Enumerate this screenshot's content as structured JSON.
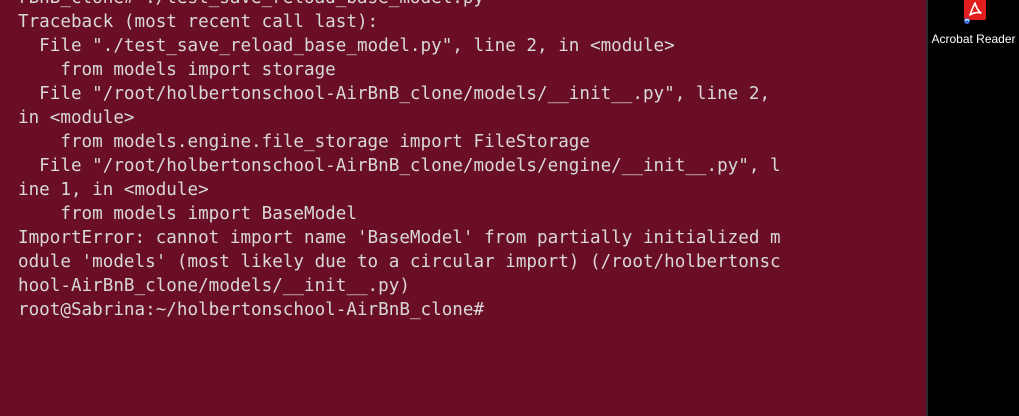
{
  "terminal": {
    "lines": [
      "rBnB_clone# ./test_save_reload_base_model.py",
      "Traceback (most recent call last):",
      "  File \"./test_save_reload_base_model.py\", line 2, in <module>",
      "    from models import storage",
      "  File \"/root/holbertonschool-AirBnB_clone/models/__init__.py\", line 2,",
      "in <module>",
      "    from models.engine.file_storage import FileStorage",
      "  File \"/root/holbertonschool-AirBnB_clone/models/engine/__init__.py\", l",
      "ine 1, in <module>",
      "    from models import BaseModel",
      "ImportError: cannot import name 'BaseModel' from partially initialized m",
      "odule 'models' (most likely due to a circular import) (/root/holbertonsc",
      "hool-AirBnB_clone/models/__init__.py)",
      "root@Sabrina:~/holbertonschool-AirBnB_clone#"
    ],
    "background": "#6a0e26",
    "foreground": "#d8d8d8"
  },
  "desktop": {
    "icon": {
      "label": "Acrobat Reader",
      "icon_name": "acrobat-reader-icon",
      "color": "#e01e1e"
    }
  }
}
